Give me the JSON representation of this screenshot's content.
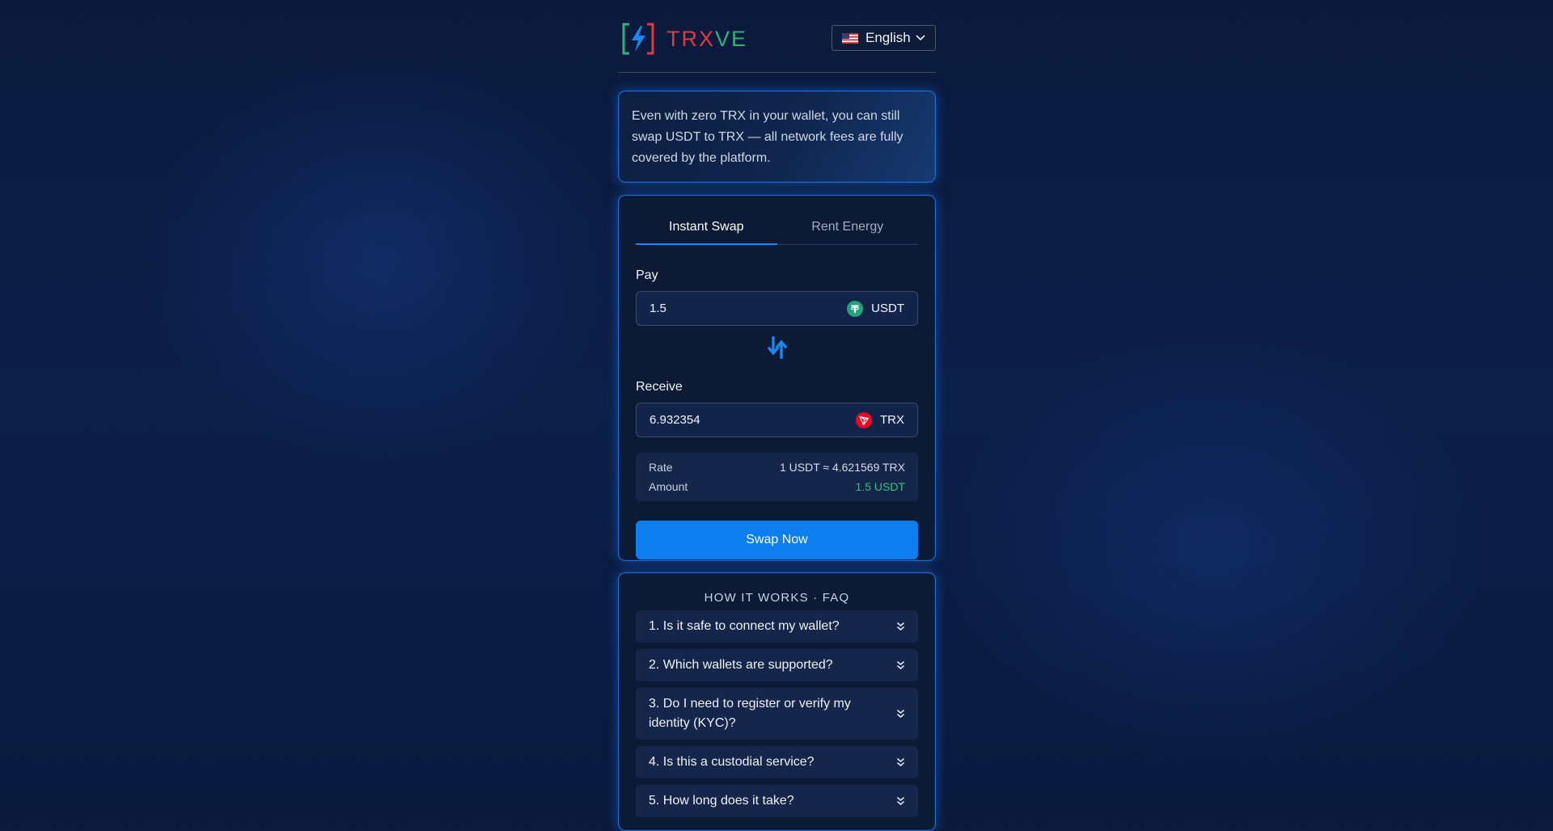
{
  "brand": {
    "name_part1": "TRX",
    "name_part2": "VE",
    "accent_red": "#e23b3b",
    "accent_green": "#2fb37a",
    "accent_blue": "#1f86ee"
  },
  "language": {
    "selected": "English",
    "flag_icon": "us-flag-icon"
  },
  "notice": {
    "text": "Even with zero TRX in your wallet, you can still swap USDT to TRX — all network fees are fully covered by the platform."
  },
  "swap": {
    "tabs": [
      {
        "label": "Instant Swap",
        "active": true
      },
      {
        "label": "Rent Energy",
        "active": false
      }
    ],
    "pay": {
      "label": "Pay",
      "value": "1.5",
      "token": "USDT",
      "token_icon": "tether-icon"
    },
    "receive": {
      "label": "Receive",
      "value": "6.932354",
      "token": "TRX",
      "token_icon": "tron-icon"
    },
    "rate": {
      "label": "Rate",
      "value": "1 USDT ≈ 4.621569 TRX"
    },
    "amount": {
      "label": "Amount",
      "value": "1.5 USDT"
    },
    "button_label": "Swap Now"
  },
  "faq": {
    "title": "HOW IT WORKS · FAQ",
    "items": [
      "1. Is it safe to connect my wallet?",
      "2. Which wallets are supported?",
      "3. Do I need to register or verify my identity (KYC)?",
      "4. Is this a custodial service?",
      "5. How long does it take?"
    ]
  }
}
